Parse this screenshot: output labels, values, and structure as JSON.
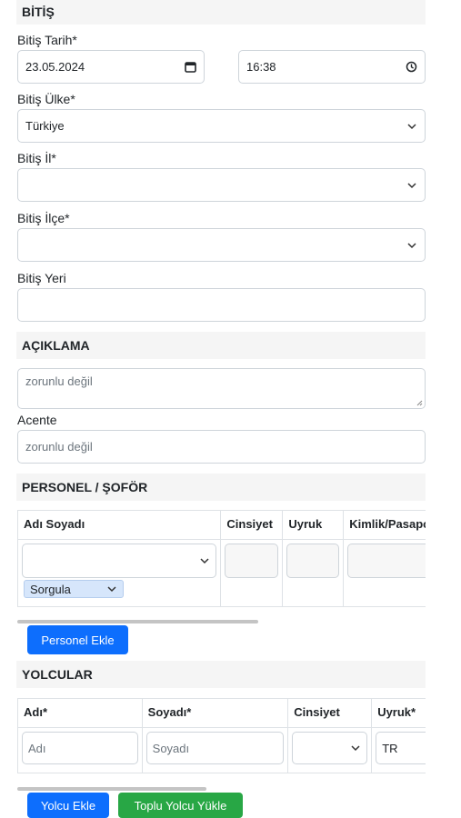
{
  "bitis": {
    "section_title": "BİTİŞ",
    "tarih_label": "Bitiş Tarih*",
    "date_value": "23.05.2024",
    "time_value": "16:38",
    "ulke_label": "Bitiş Ülke*",
    "ulke_value": "Türkiye",
    "il_label": "Bitiş İl*",
    "il_value": "",
    "ilce_label": "Bitiş İlçe*",
    "ilce_value": "",
    "yeri_label": "Bitiş Yeri",
    "yeri_value": ""
  },
  "aciklama": {
    "section_title": "AÇIKLAMA",
    "placeholder": "zorunlu değil",
    "acente_label": "Acente",
    "acente_placeholder": "zorunlu değil"
  },
  "personel": {
    "section_title": "PERSONEL / ŞOFÖR",
    "columns": [
      "Adı Soyadı",
      "Cinsiyet",
      "Uyruk",
      "Kimlik/Pasaport"
    ],
    "sorgula_value": "Sorgula",
    "add_button": "Personel Ekle"
  },
  "yolcular": {
    "section_title": "YOLCULAR",
    "columns": [
      "Adı*",
      "Soyadı*",
      "Cinsiyet",
      "Uyruk*"
    ],
    "adi_placeholder": "Adı",
    "soyadi_placeholder": "Soyadı",
    "uyruk_value": "TR",
    "add_button": "Yolcu Ekle",
    "bulk_button": "Toplu Yolcu Yükle"
  },
  "colors": {
    "primary": "#0d6efd",
    "success": "#28a745",
    "section_bg": "#f5f5f5"
  }
}
